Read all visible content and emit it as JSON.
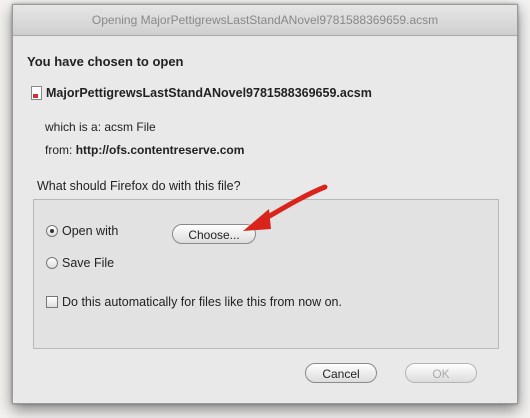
{
  "window": {
    "title": "Opening MajorPettigrewsLastStandANovel9781588369659.acsm"
  },
  "dialog": {
    "heading": "You have chosen to open",
    "file_name": "MajorPettigrewsLastStandANovel9781588369659.acsm",
    "which_label": "which is a:",
    "which_value": "acsm File",
    "from_label": "from:",
    "from_value": "http://ofs.contentreserve.com",
    "question": "What should Firefox do with this file?"
  },
  "options": {
    "open_with_label": "Open with",
    "open_with_selected": true,
    "choose_label": "Choose...",
    "save_file_label": "Save File",
    "save_file_selected": false,
    "auto_label": "Do this automatically for files like this from now on.",
    "auto_checked": false
  },
  "buttons": {
    "cancel_label": "Cancel",
    "ok_label": "OK"
  },
  "colors": {
    "arrow": "#d9241c",
    "dialog_bg": "#e9e9e9"
  },
  "icons": {
    "file": "acsm-file-icon",
    "arrow": "red-pointer-arrow"
  }
}
